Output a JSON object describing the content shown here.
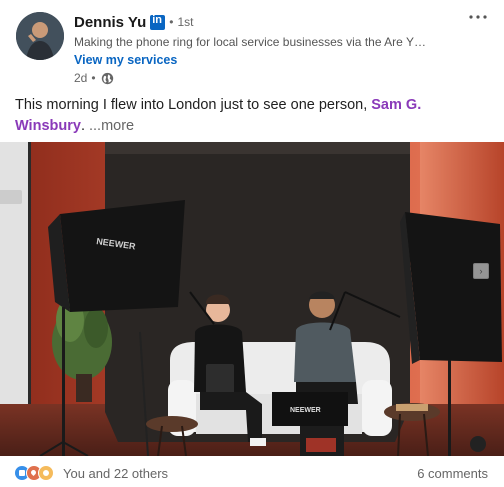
{
  "author": {
    "name": "Dennis Yu",
    "degree": "1st",
    "headline": "Making the phone ring for local service businesses via the Are Y…",
    "services_link": "View my services",
    "time": "2d",
    "visibility_icon": "globe-icon",
    "badge_icon": "linkedin-icon"
  },
  "post": {
    "text_before": "This morning I flew into London just to see one person, ",
    "mention": "Sam G. Winsbury",
    "text_after": ".",
    "see_more": "...more"
  },
  "image": {
    "softbox_brand": "NEEWER",
    "box_brand": "NEEWER",
    "next_icon": "chevron-right-icon"
  },
  "social": {
    "reaction_icons": [
      "like-icon",
      "love-icon",
      "insightful-icon"
    ],
    "reactions_text": "You and 22 others",
    "comments_text": "6 comments"
  },
  "colors": {
    "link": "#0a66c2",
    "mention": "#8a3ab9"
  }
}
